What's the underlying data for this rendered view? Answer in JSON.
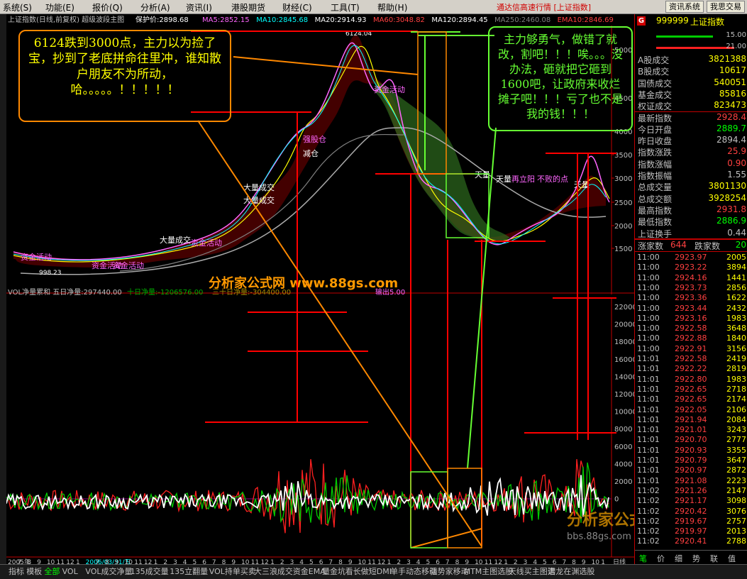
{
  "menu": {
    "items": [
      "系统(S)",
      "功能(E)",
      "报价(Q)",
      "分析(A)",
      "资讯(I)",
      "港股期货",
      "财经(C)",
      "工具(T)",
      "帮助(H)"
    ],
    "right_text": "通达信高速行情 [上证指数]",
    "buttons": [
      "资讯系统",
      "我思交易"
    ]
  },
  "chart": {
    "title": "上证指数(日线,前复权)  超级波段主图",
    "protect_price": "保护价:2898.68",
    "ma": [
      {
        "label": "MA5:2852.15",
        "color": "#ff66ff"
      },
      {
        "label": "MA10:2845.68",
        "color": "#00ffff"
      },
      {
        "label": "MA20:2914.93",
        "color": "#ffffff"
      },
      {
        "label": "MA60:3048.82",
        "color": "#ff4040"
      },
      {
        "label": "MA120:2894.45",
        "color": "#ffffff"
      },
      {
        "label": "MA250:2460.08",
        "color": "#808080"
      },
      {
        "label": "EMA10:2846.69",
        "color": "#ff4040"
      }
    ],
    "peak_label": "6124.04",
    "low_label": "998.23",
    "y_ticks": [
      "5000",
      "4500",
      "4000",
      "3500",
      "3000",
      "2500",
      "2000",
      "1500"
    ],
    "vol_title": "VOL净量累和  五日净量:297440.00",
    "vol_sub": [
      "十日净量:-1206576.00",
      "三十日净量:-304400.00",
      "输出5.00"
    ],
    "vol_y_ticks": [
      "22000",
      "20000",
      "18000",
      "16000",
      "14000",
      "12000",
      "10000",
      "8000",
      "6000",
      "4000",
      "2000",
      "0"
    ],
    "x_labels": [
      "2005年",
      "7",
      "8",
      "9",
      "10",
      "11",
      "12",
      "1",
      "2006/03/31/五",
      "7",
      "8",
      "9",
      "10",
      "11",
      "12",
      "1",
      "2",
      "3",
      "4",
      "5",
      "6",
      "7",
      "8",
      "9",
      "10",
      "11",
      "12",
      "1",
      "2",
      "3",
      "4",
      "5",
      "6",
      "7",
      "8",
      "9",
      "10",
      "11",
      "12",
      "1",
      "2",
      "3",
      "4",
      "5",
      "6",
      "7",
      "8",
      "9",
      "10",
      "11",
      "12",
      "1",
      "2",
      "3",
      "4",
      "5",
      "6",
      "7",
      "8",
      "9",
      "10",
      "1"
    ],
    "x_end": "日线",
    "chart_labels": [
      "大量成交",
      "大量成交",
      "强股仓",
      "减仓",
      "资金活动",
      "大量成交",
      "资金活动",
      "资金活动",
      "资金活动",
      "资金活动",
      "天量",
      "天量",
      "再立阳",
      "不败的点",
      "天量"
    ],
    "watermark_center": "分析家公式网  www.88gs.com",
    "watermark_corner": "分析家公式网",
    "watermark_corner_url": "bbs.88gs.com"
  },
  "annotations": {
    "left": "6124跌到3000点，主力以为捡了宝，抄到了老底拼命往里冲，谁知散户朋友不为所动，哈。。。。。！！！！！",
    "right": "主力够勇气，做错了就改，割吧！！！唉。。。没办法，砸就把它砸到1600吧，让政府来收烂摊子吧！！！亏了也不是我的钱！！！"
  },
  "panel": {
    "badge": "G",
    "code": "999999",
    "name": "上证指数",
    "mini_vals": [
      "15.00",
      "21.00"
    ],
    "stats": [
      {
        "k": "A股成交",
        "v": "3821388",
        "c": "#ffff00"
      },
      {
        "k": "B股成交",
        "v": "10617",
        "c": "#ffff00"
      },
      {
        "k": "国债成交",
        "v": "540051",
        "c": "#ffff00"
      },
      {
        "k": "基金成交",
        "v": "85816",
        "c": "#ffff00"
      },
      {
        "k": "权证成交",
        "v": "823473",
        "c": "#ffff00"
      },
      {
        "k": "最新指数",
        "v": "2928.4",
        "c": "#ff4040"
      },
      {
        "k": "今日开盘",
        "v": "2889.7",
        "c": "#00ff00"
      },
      {
        "k": "昨日收盘",
        "v": "2894.4",
        "c": "#c0c0c0"
      },
      {
        "k": "指数涨跌",
        "v": "25.9",
        "c": "#ff4040"
      },
      {
        "k": "指数涨幅",
        "v": "0.90",
        "c": "#ff4040"
      },
      {
        "k": "指数振幅",
        "v": "1.55",
        "c": "#c0c0c0"
      },
      {
        "k": "总成交量",
        "v": "3801130",
        "c": "#ffff00"
      },
      {
        "k": "总成交额",
        "v": "3928254",
        "c": "#ffff00"
      },
      {
        "k": "最高指数",
        "v": "2931.8",
        "c": "#ff4040"
      },
      {
        "k": "最低指数",
        "v": "2886.9",
        "c": "#00ff00"
      },
      {
        "k": "上证换手",
        "v": "0.44",
        "c": "#c0c0c0"
      }
    ],
    "updown": {
      "up_label": "涨家数",
      "up_value": "644",
      "down_label": "跌家数",
      "down_value": "20"
    },
    "ticks": [
      {
        "t": "11:00",
        "p": "2923.97",
        "q": "2005"
      },
      {
        "t": "11:00",
        "p": "2923.22",
        "q": "3894"
      },
      {
        "t": "11:00",
        "p": "2924.16",
        "q": "1441"
      },
      {
        "t": "11:00",
        "p": "2923.73",
        "q": "2856"
      },
      {
        "t": "11:00",
        "p": "2923.36",
        "q": "1622"
      },
      {
        "t": "11:00",
        "p": "2923.44",
        "q": "2432"
      },
      {
        "t": "11:00",
        "p": "2923.16",
        "q": "1983"
      },
      {
        "t": "11:00",
        "p": "2922.58",
        "q": "3648"
      },
      {
        "t": "11:00",
        "p": "2922.88",
        "q": "1840"
      },
      {
        "t": "11:00",
        "p": "2922.91",
        "q": "3156"
      },
      {
        "t": "11:01",
        "p": "2922.58",
        "q": "2419"
      },
      {
        "t": "11:01",
        "p": "2922.22",
        "q": "2819"
      },
      {
        "t": "11:01",
        "p": "2922.80",
        "q": "1983"
      },
      {
        "t": "11:01",
        "p": "2922.65",
        "q": "2718"
      },
      {
        "t": "11:01",
        "p": "2922.65",
        "q": "2174"
      },
      {
        "t": "11:01",
        "p": "2922.05",
        "q": "2106"
      },
      {
        "t": "11:01",
        "p": "2921.94",
        "q": "2084"
      },
      {
        "t": "11:01",
        "p": "2921.01",
        "q": "3243"
      },
      {
        "t": "11:01",
        "p": "2920.70",
        "q": "2777"
      },
      {
        "t": "11:01",
        "p": "2920.93",
        "q": "3355"
      },
      {
        "t": "11:01",
        "p": "2920.79",
        "q": "3647"
      },
      {
        "t": "11:01",
        "p": "2920.97",
        "q": "2872"
      },
      {
        "t": "11:01",
        "p": "2921.08",
        "q": "2223"
      },
      {
        "t": "11:02",
        "p": "2921.26",
        "q": "2147"
      },
      {
        "t": "11:02",
        "p": "2921.17",
        "q": "3098"
      },
      {
        "t": "11:02",
        "p": "2920.42",
        "q": "3076"
      },
      {
        "t": "11:02",
        "p": "2919.67",
        "q": "2757"
      },
      {
        "t": "11:02",
        "p": "2919.97",
        "q": "2013"
      },
      {
        "t": "11:02",
        "p": "2920.41",
        "q": "2788"
      }
    ],
    "bottom_tabs": [
      "笔",
      "价",
      "细",
      "势",
      "联",
      "值"
    ]
  },
  "bottom_tabs": [
    "指标",
    "模板",
    "全部",
    "VOL",
    "VOL成交净量",
    "135成交量",
    "135立翻量",
    "VOL持单买卖",
    "大三浪",
    "成交资金EMA",
    "量金坑",
    "看长做短DMI",
    "单手动态移动",
    "强势家移动",
    "MTM主图选股",
    "天线买主图选",
    "潜龙在渊选股"
  ],
  "bottom_active_index": 2
}
